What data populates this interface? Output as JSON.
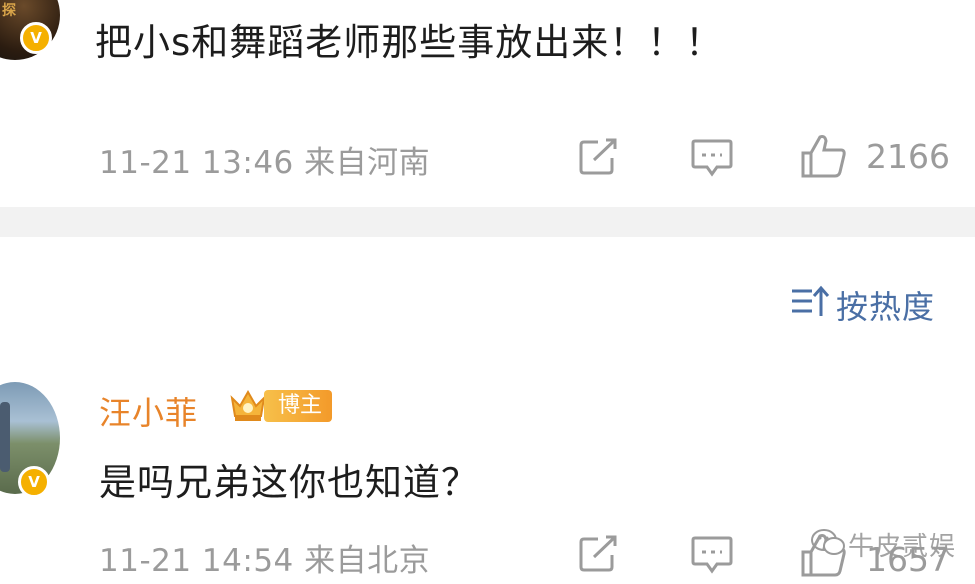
{
  "post": {
    "text": "把小s和舞蹈老师那些事放出来！！！",
    "timestamp": "11-21 13:46",
    "location": "来自河南",
    "like_count": "2166",
    "avatar_badge": "V",
    "icons": [
      "share-icon",
      "comment-icon",
      "like-icon"
    ]
  },
  "sort": {
    "label": "按热度",
    "icon": "sort-icon"
  },
  "comment": {
    "username": "汪小菲",
    "badge_label": "博主",
    "avatar_badge": "V",
    "text": "是吗兄弟这你也知道？",
    "timestamp": "11-21 14:54",
    "location": "来自北京",
    "like_count": "1657"
  },
  "colors": {
    "username": "#e8842a",
    "sort_label": "#4a6fa5",
    "meta_gray": "#9b9b9b",
    "vip_badge": "#f5b000",
    "divider": "#f2f2f2"
  },
  "watermark": {
    "text": "牛皮贰娱"
  }
}
